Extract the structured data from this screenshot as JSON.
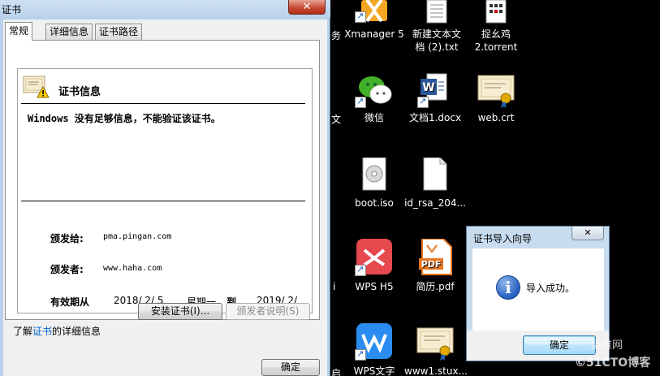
{
  "cert_dialog": {
    "title": "证书",
    "close": "✕",
    "tabs": [
      "常规",
      "详细信息",
      "证书路径"
    ],
    "info_heading": "证书信息",
    "warning": "Windows 没有足够信息，不能验证该证书。",
    "issued_to_label": "颁发给:",
    "issued_to": "pma.pingan.com",
    "issued_by_label": "颁发者:",
    "issued_by": "www.haha.com",
    "valid_label": "有效期从",
    "valid_from": "2018/  2/  5",
    "valid_weekday": "星期一",
    "valid_to_label": "到",
    "valid_to": "2019/  2/",
    "install_button": "安装证书(I)...",
    "issuer_statement_button": "颁发者说明(S)",
    "learn_prefix": "了解",
    "learn_link": "证书",
    "learn_suffix": "的详细信息",
    "ok_button": "确定"
  },
  "desktop": {
    "edge_fragments": [
      "务",
      "文",
      "i",
      "启"
    ],
    "icons": [
      {
        "label": "Xmanager 5",
        "icon": "xmanager-icon"
      },
      {
        "label": "新建文本文",
        "label2": "档 (2).txt",
        "icon": "text-file-icon"
      },
      {
        "label": "捉幺鸡",
        "label2": "2.torrent",
        "icon": "torrent-file-icon"
      },
      {
        "label": "微信",
        "icon": "wechat-icon"
      },
      {
        "label": "文档1.docx",
        "icon": "word-doc-icon"
      },
      {
        "label": "web.crt",
        "icon": "certificate-icon"
      },
      {
        "label": "boot.iso",
        "icon": "disc-image-icon"
      },
      {
        "label": "id_rsa_204...",
        "icon": "blank-file-icon"
      },
      {
        "label": "WPS H5",
        "icon": "wps-h5-icon"
      },
      {
        "label": "简历.pdf",
        "icon": "pdf-icon"
      },
      {
        "label": "WPS文字",
        "icon": "wps-writer-icon"
      },
      {
        "label": "www1.stux...",
        "icon": "certificate-icon"
      }
    ]
  },
  "import_wizard": {
    "title": "证书导入向导",
    "close": "✕",
    "message": "导入成功。",
    "ok_button": "确定"
  },
  "watermark": {
    "line1": "运维网",
    "line2": "©51CTO博客"
  }
}
